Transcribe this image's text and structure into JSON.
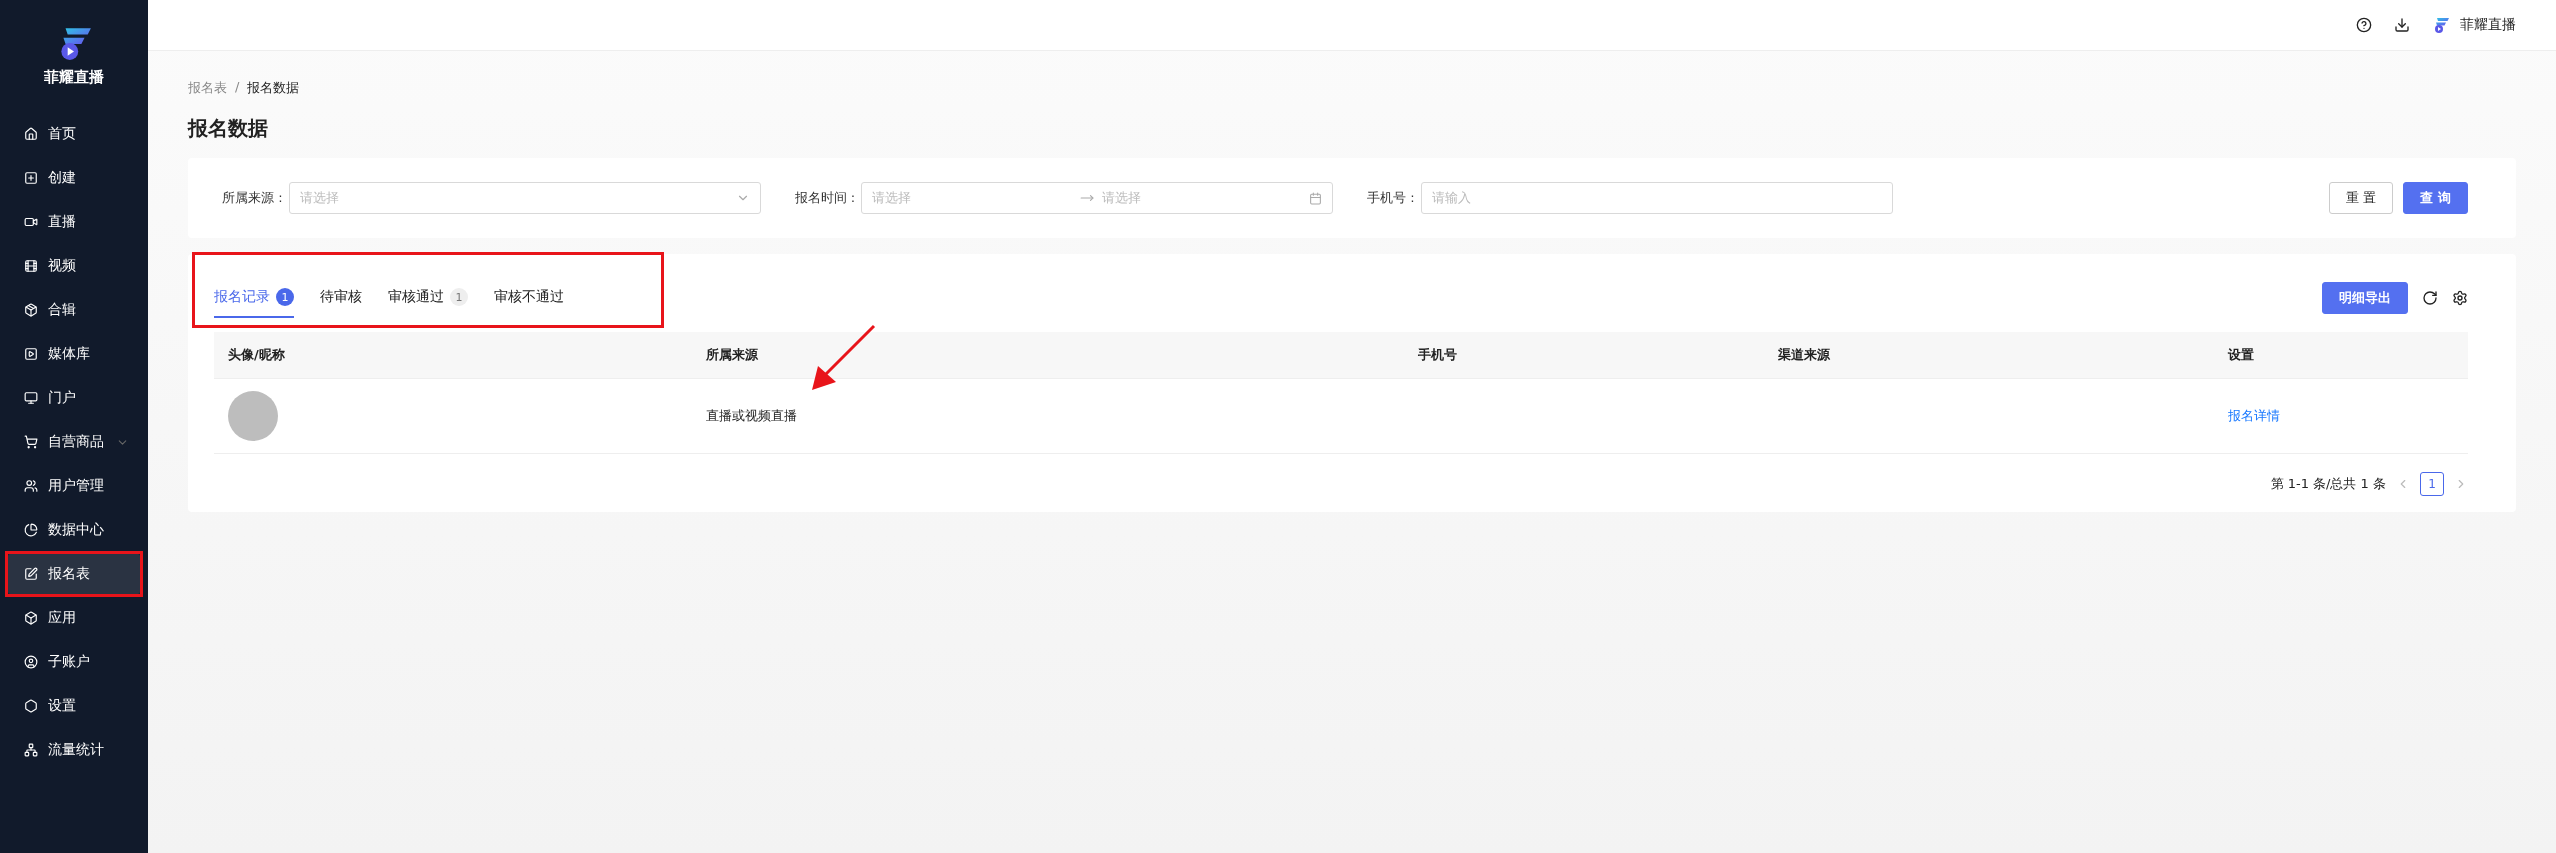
{
  "sidebar": {
    "brand": "菲耀直播",
    "items": [
      {
        "label": "首页",
        "kind": "link",
        "selected": false
      },
      {
        "label": "创建",
        "kind": "link",
        "selected": false
      },
      {
        "label": "直播",
        "kind": "link",
        "selected": false
      },
      {
        "label": "视频",
        "kind": "link",
        "selected": false
      },
      {
        "label": "合辑",
        "kind": "link",
        "selected": false
      },
      {
        "label": "媒体库",
        "kind": "link",
        "selected": false
      },
      {
        "label": "门户",
        "kind": "link",
        "selected": false
      },
      {
        "label": "自营商品",
        "kind": "group",
        "selected": false
      },
      {
        "label": "用户管理",
        "kind": "link",
        "selected": false
      },
      {
        "label": "数据中心",
        "kind": "link",
        "selected": false
      },
      {
        "label": "报名表",
        "kind": "link",
        "selected": true
      },
      {
        "label": "应用",
        "kind": "link",
        "selected": false
      },
      {
        "label": "子账户",
        "kind": "link",
        "selected": false
      },
      {
        "label": "设置",
        "kind": "link",
        "selected": false
      },
      {
        "label": "流量统计",
        "kind": "link",
        "selected": false
      }
    ]
  },
  "header": {
    "account": "菲耀直播"
  },
  "breadcrumb": {
    "separator": "/",
    "items": [
      "报名表",
      "报名数据"
    ]
  },
  "page_title": "报名数据",
  "filters": {
    "source": {
      "label": "所属来源 :",
      "placeholder": "请选择"
    },
    "time": {
      "label": "报名时间 :",
      "start_placeholder": "请选择",
      "end_placeholder": "请选择"
    },
    "phone": {
      "label": "手机号 :",
      "placeholder": "请输入"
    },
    "buttons": [
      "重 置",
      "查 询"
    ]
  },
  "tabs": [
    {
      "label": "报名记录",
      "count": "1",
      "selected": true
    },
    {
      "label": "待审核",
      "selected": false
    },
    {
      "label": "审核通过",
      "count": "1",
      "selected": false
    },
    {
      "label": "审核不通过",
      "selected": false
    }
  ],
  "export_button": "明细导出",
  "table": {
    "columns": [
      "头像/昵称",
      "所属来源",
      "手机号",
      "渠道来源",
      "设置"
    ],
    "rows": [
      {
        "source": "直播或视频直播",
        "action": "报名详情"
      }
    ]
  },
  "pagination": {
    "summary": "第 1-1 条/总共 1 条",
    "pages": [
      {
        "label": "1",
        "selected": true
      }
    ]
  },
  "annotations": {
    "sidebar_frame": true,
    "tabs_frame": true,
    "arrow": true
  }
}
